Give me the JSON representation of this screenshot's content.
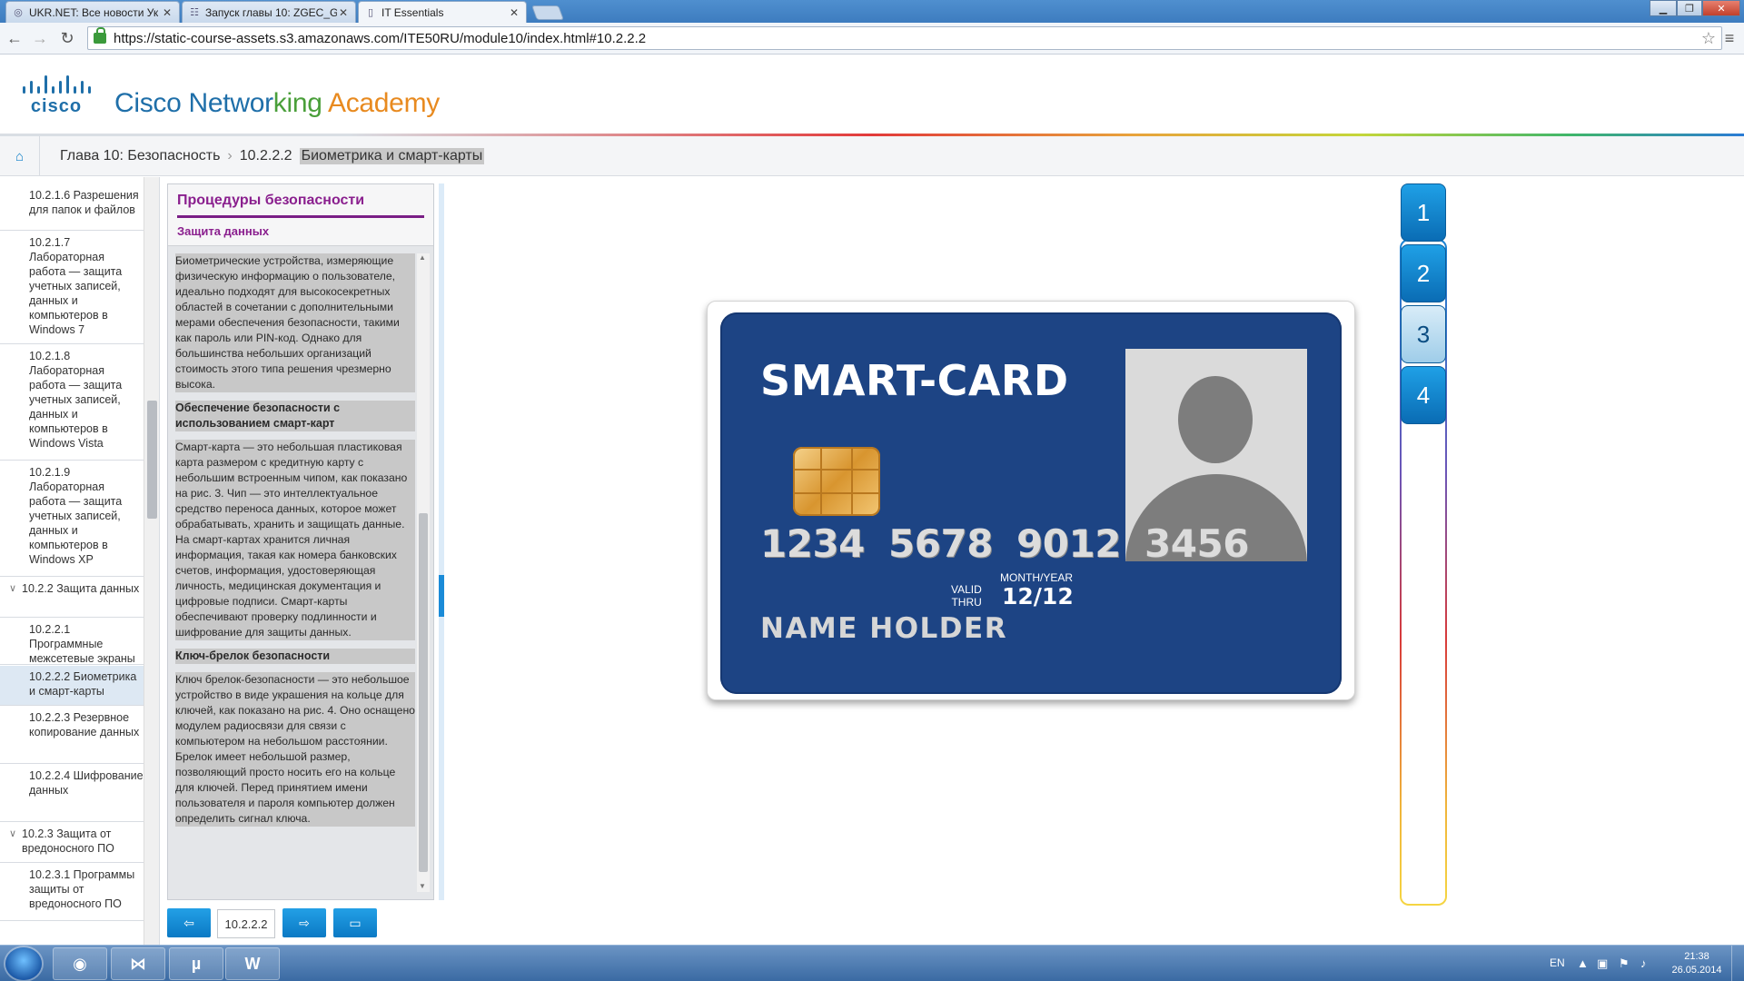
{
  "browser": {
    "tabs": [
      {
        "label": "UKR.NET: Все новости Ук",
        "icon": "ukrnet-icon"
      },
      {
        "label": "Запуск главы 10: ZGEC_G",
        "icon": "course-icon"
      },
      {
        "label": "IT Essentials",
        "icon": "page-icon"
      }
    ],
    "url": "https://static-course-assets.s3.amazonaws.com/ITE50RU/module10/index.html#10.2.2.2"
  },
  "header": {
    "brand_parts": [
      "Cisco Networ",
      "king ",
      "Academy"
    ],
    "logo_text": "cisco"
  },
  "breadcrumb": {
    "chapter": "Глава 10: Безопасность",
    "section_num": "10.2.2.2",
    "section_title": "Биометрика и смарт-карты"
  },
  "sidebar": {
    "items": [
      {
        "label": "10.2.1.6 Разрешения для папок и файлов"
      },
      {
        "label": "10.2.1.7 Лабораторная работа — защита учетных записей, данных и компьютеров в Windows 7"
      },
      {
        "label": "10.2.1.8 Лабораторная работа — защита учетных записей, данных и компьютеров в Windows Vista"
      },
      {
        "label": "10.2.1.9 Лабораторная работа — защита учетных записей, данных и компьютеров в Windows XP"
      },
      {
        "label": "10.2.2 Защита данных"
      },
      {
        "label": "10.2.2.1 Программные межсетевые экраны"
      },
      {
        "label": "10.2.2.2 Биометрика и смарт-карты"
      },
      {
        "label": "10.2.2.3 Резервное копирование данных"
      },
      {
        "label": "10.2.2.4 Шифрование данных"
      },
      {
        "label": "10.2.3 Защита от вредоносного ПО"
      },
      {
        "label": "10.2.3.1 Программы защиты от вредоносного ПО"
      }
    ]
  },
  "panel": {
    "title": "Процедуры безопасности",
    "subtitle": "Защита данных",
    "p1": "Биометрические устройства, измеряющие физическую информацию о пользователе, идеально подходят для высокосекретных областей в сочетании с дополнительными мерами обеспечения безопасности, такими как пароль или PIN-код. Однако для большинства небольших организаций стоимость этого типа решения чрезмерно высока.",
    "h2": "Обеспечение безопасности с использованием смарт-карт",
    "p2": "Смарт-карта — это небольшая пластиковая карта размером с кредитную карту с небольшим встроенным чипом, как показано на рис. 3. Чип — это интеллектуальное средство переноса данных, которое может обрабатывать, хранить и защищать данные. На смарт-картах хранится личная информация, такая как номера банковских счетов, информация, удостоверяющая личность, медицинская документация и цифровые подписи. Смарт-карты обеспечивают проверку подлинности и шифрование для защиты данных.",
    "h3": "Ключ-брелок безопасности",
    "p3": "Ключ брелок-безопасности — это небольшое устройство в виде украшения на кольце для ключей, как показано на рис. 4. Оно оснащено модулем радиосвязи для связи с компьютером на небольшом расстоянии. Брелок имеет небольшой размер, позволяющий просто носить его на кольце для ключей. Перед принятием имени пользователя и пароля компьютер должен определить сигнал ключа."
  },
  "bottom_nav": {
    "page_number": "10.2.2.2"
  },
  "card": {
    "title": "SMART-CARD",
    "number": "1234 5678 9012 3456",
    "valid_label_1": "VALID",
    "valid_label_2": "THRU",
    "month_year": "MONTH/YEAR",
    "expiry": "12/12",
    "holder": "NAME HOLDER"
  },
  "figures": {
    "buttons": [
      "1",
      "2",
      "3",
      "4"
    ],
    "selected": "3"
  },
  "taskbar": {
    "lang": "EN",
    "time": "21:38",
    "date": "26.05.2014"
  }
}
